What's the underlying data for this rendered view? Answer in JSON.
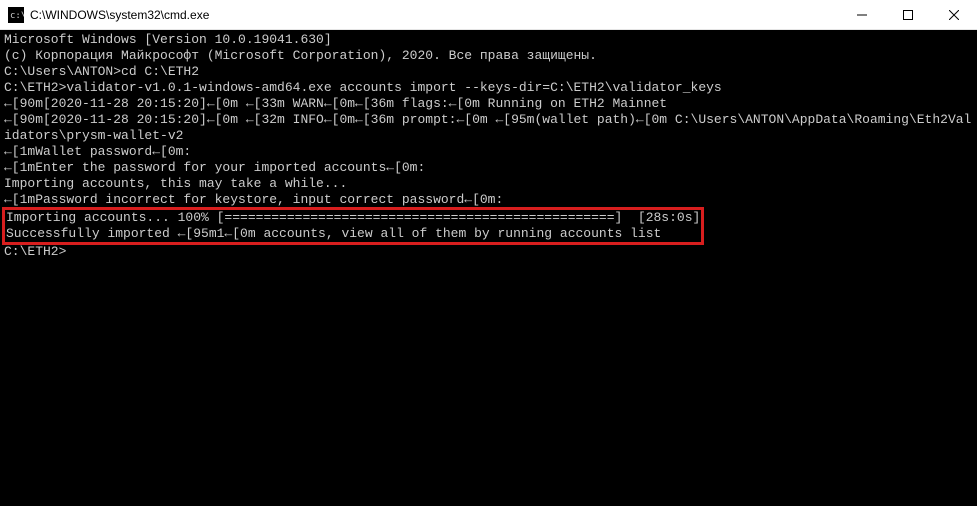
{
  "window": {
    "title": "C:\\WINDOWS\\system32\\cmd.exe"
  },
  "terminal": {
    "line1": "Microsoft Windows [Version 10.0.19041.630]",
    "line2": "(c) Корпорация Майкрософт (Microsoft Corporation), 2020. Все права защищены.",
    "blank1": "",
    "line3": "C:\\Users\\ANTON>cd C:\\ETH2",
    "blank2": "",
    "line4": "C:\\ETH2>validator-v1.0.1-windows-amd64.exe accounts import --keys-dir=C:\\ETH2\\validator_keys",
    "line5": "←[90m[2020-11-28 20:15:20]←[0m ←[33m WARN←[0m←[36m flags:←[0m Running on ETH2 Mainnet",
    "line6": "←[90m[2020-11-28 20:15:20]←[0m ←[32m INFO←[0m←[36m prompt:←[0m ←[95m(wallet path)←[0m C:\\Users\\ANTON\\AppData\\Roaming\\Eth2Validators\\prysm-wallet-v2",
    "line7": "←[1mWallet password←[0m:",
    "line8": "←[1mEnter the password for your imported accounts←[0m:",
    "line9": "Importing accounts, this may take a while...",
    "line10": "←[1mPassword incorrect for keystore, input correct password←[0m:",
    "highlighted": {
      "h1": "Importing accounts... 100% [==================================================]  [28s:0s]",
      "h2": "Successfully imported ←[95m1←[0m accounts, view all of them by running accounts list"
    },
    "blank3": "",
    "line11": "C:\\ETH2>"
  }
}
